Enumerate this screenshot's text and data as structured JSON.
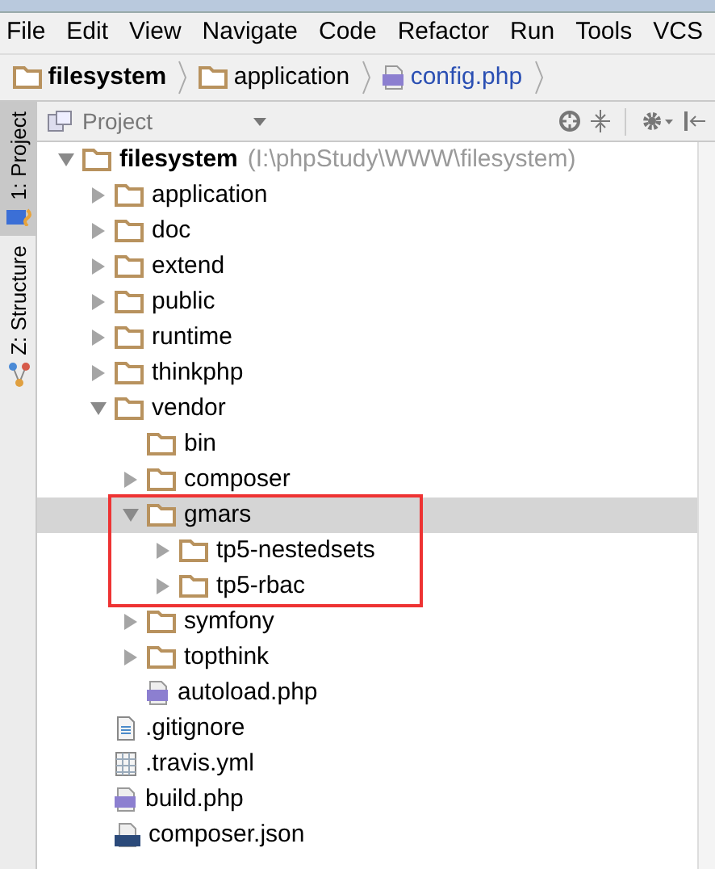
{
  "menu": [
    "File",
    "Edit",
    "View",
    "Navigate",
    "Code",
    "Refactor",
    "Run",
    "Tools",
    "VCS"
  ],
  "breadcrumb": [
    {
      "label": "filesystem",
      "kind": "project"
    },
    {
      "label": "application",
      "kind": "folder"
    },
    {
      "label": "config.php",
      "kind": "php"
    }
  ],
  "side_tabs": [
    {
      "label": "1: Project",
      "kind": "project",
      "selected": true
    },
    {
      "label": "Z: Structure",
      "kind": "structure",
      "selected": false
    }
  ],
  "panel": {
    "title": "Project"
  },
  "tree": [
    {
      "label": "filesystem",
      "path": "(I:\\phpStudy\\WWW\\filesystem)",
      "kind": "folder",
      "expanded": true,
      "selected": false,
      "children": [
        {
          "label": "application",
          "kind": "folder",
          "expanded": false,
          "selected": false
        },
        {
          "label": "doc",
          "kind": "folder",
          "expanded": false,
          "selected": false
        },
        {
          "label": "extend",
          "kind": "folder",
          "expanded": false,
          "selected": false
        },
        {
          "label": "public",
          "kind": "folder",
          "expanded": false,
          "selected": false
        },
        {
          "label": "runtime",
          "kind": "folder",
          "expanded": false,
          "selected": false
        },
        {
          "label": "thinkphp",
          "kind": "folder",
          "expanded": false,
          "selected": false
        },
        {
          "label": "vendor",
          "kind": "folder",
          "expanded": true,
          "selected": false,
          "children": [
            {
              "label": "bin",
              "kind": "folder",
              "selected": false
            },
            {
              "label": "composer",
              "kind": "folder",
              "expanded": false,
              "selected": false
            },
            {
              "label": "gmars",
              "kind": "folder",
              "expanded": true,
              "selected": true,
              "annotated": true,
              "children": [
                {
                  "label": "tp5-nestedsets",
                  "kind": "folder",
                  "expanded": false,
                  "selected": false
                },
                {
                  "label": "tp5-rbac",
                  "kind": "folder",
                  "expanded": false,
                  "selected": false
                }
              ]
            },
            {
              "label": "symfony",
              "kind": "folder",
              "expanded": false,
              "selected": false
            },
            {
              "label": "topthink",
              "kind": "folder",
              "expanded": false,
              "selected": false
            },
            {
              "label": "autoload.php",
              "kind": "php",
              "selected": false
            }
          ]
        },
        {
          "label": ".gitignore",
          "kind": "text",
          "selected": false
        },
        {
          "label": ".travis.yml",
          "kind": "yml",
          "selected": false
        },
        {
          "label": "build.php",
          "kind": "php",
          "selected": false
        },
        {
          "label": "composer.json",
          "kind": "json",
          "selected": false
        }
      ]
    }
  ]
}
